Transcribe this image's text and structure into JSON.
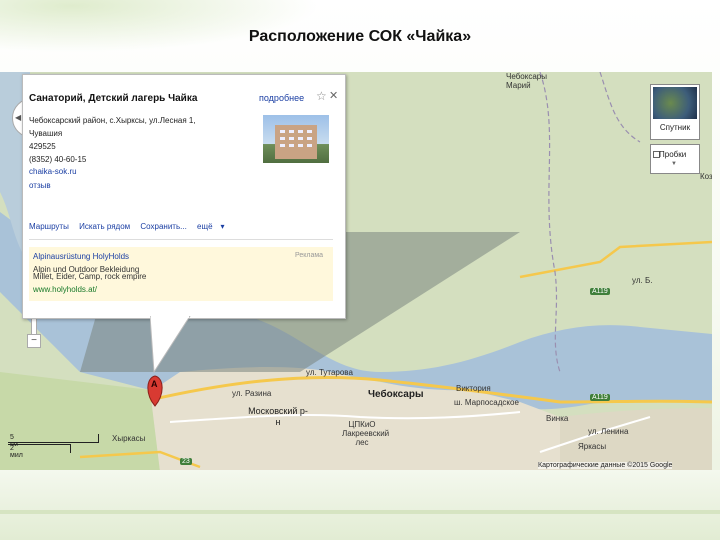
{
  "slide": {
    "title": "Расположение СОК «Чайка»"
  },
  "popup": {
    "title": "Санаторий, Детский лагерь Чайка",
    "more_link": "подробнее",
    "address_line1": "Чебоксарский район, с.Хырксы, ул.Лесная 1,",
    "address_line2": "Чувашия",
    "postcode": "429525",
    "phone": "(8352) 40-60-15",
    "website": "chaika-sok.ru",
    "reviews": "отзыв",
    "actions": [
      "Маршруты",
      "Искать рядом",
      "Сохранить...",
      "ещё"
    ],
    "ad": {
      "title": "Alpinausrüstung HolyHolds",
      "line1": "Alpin und Outdoor Bekleidung",
      "line2": "Millet, Eider, Camp, rock empire",
      "url": "www.holyholds.at/",
      "tag": "Реклама"
    }
  },
  "map_controls": {
    "satellite": "Спутник",
    "traffic": "Пробки",
    "zoom_in": "+",
    "zoom_out": "−"
  },
  "marker": {
    "letter": "A"
  },
  "labels": {
    "city": "Чебоксары",
    "district": "Московский р-н",
    "park": "ЦПКиО Лакреевский лес",
    "victoria": "Виктория",
    "street_marpos": "ш. Марпосадское",
    "street_lrazina": "ул. Разина",
    "street_tutorov": "ул. Тутарова",
    "street_lenina": "ул. Ленина",
    "street_lb": "ул. Б.",
    "hyrkasy": "Хыркасы",
    "yarkasy": "Яркасы",
    "vinka": "Винка",
    "cheb_mari": "Чебоксары Марий",
    "koz": "Коз",
    "road_a119a": "А119",
    "road_a119b": "А119",
    "road_23": "23"
  },
  "scale": {
    "km": "5 км",
    "mi": "2 мил"
  },
  "copyright": "Картографические данные ©2015 Google"
}
